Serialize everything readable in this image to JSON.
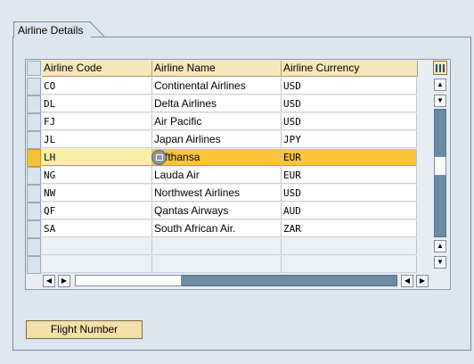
{
  "group": {
    "title": "Airline Details"
  },
  "table": {
    "columns": [
      "Airline Code",
      "Airline Name",
      "Airline Currency"
    ],
    "rows": [
      [
        "CO",
        "Continental Airlines",
        "USD"
      ],
      [
        "DL",
        "Delta Airlines",
        "USD"
      ],
      [
        "FJ",
        "Air Pacific",
        "USD"
      ],
      [
        "JL",
        "Japan Airlines",
        "JPY"
      ],
      [
        "LH",
        "fthansa",
        "EUR"
      ],
      [
        "NG",
        "Lauda Air",
        "EUR"
      ],
      [
        "NW",
        "Northwest Airlines",
        "USD"
      ],
      [
        "QF",
        "Qantas Airways",
        "AUD"
      ],
      [
        "SA",
        "South African Air.",
        "ZAR"
      ]
    ],
    "selected_row": 4,
    "empty_rows": 2
  },
  "buttons": {
    "flight_number": "Flight Number"
  },
  "icons": {
    "table_settings": "table-settings-icon",
    "value_help": "value-help-icon",
    "scroll_up": "arrow-up-icon",
    "scroll_down": "arrow-down-icon",
    "scroll_left": "arrow-left-icon",
    "scroll_right": "arrow-right-icon"
  },
  "colors": {
    "selected_row": "#fbc53b",
    "header": "#f7e7b8",
    "background": "#dfe6ee"
  }
}
